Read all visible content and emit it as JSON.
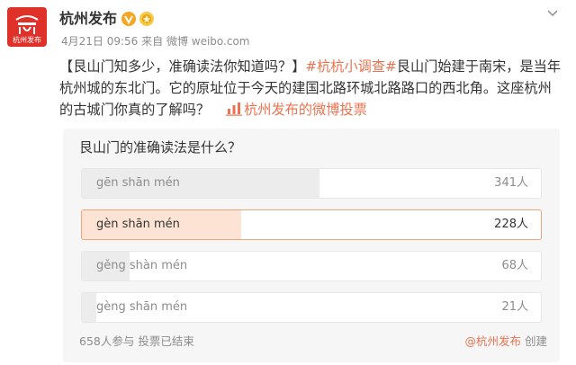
{
  "account": {
    "name": "杭州发布",
    "avatar_text": "杭州发布",
    "avatar_color": "#e0302a"
  },
  "meta": {
    "date": "4月21日 09:56",
    "source": "来自 微博 weibo.com"
  },
  "post": {
    "text_lead": "【艮山门知多少，准确读法你知道吗？】",
    "topic": "#杭杭小调查#",
    "text_body": "艮山门始建于南宋，是当年杭州城的东北门。它的原址位于今天的建国北路环城北路路口的西北角。这座杭州的古城门你真的了解吗？",
    "poll_link": "杭州发布的微博投票",
    "accent_color": "#eb7350"
  },
  "poll": {
    "question": "艮山门的准确读法是什么？",
    "options": [
      {
        "label": "gēn shān mén",
        "count": "341人",
        "votes": 341,
        "selected": false
      },
      {
        "label": "gèn shān mén",
        "count": "228人",
        "votes": 228,
        "selected": true
      },
      {
        "label": "gěng shàn mén",
        "count": "68人",
        "votes": 68,
        "selected": false
      },
      {
        "label": "gèng shān mén",
        "count": "21人",
        "votes": 21,
        "selected": false
      }
    ],
    "total_votes": 658,
    "footer_status": "658人参与 投票已结束",
    "creator": "@杭州发布",
    "creator_suffix": "创建"
  },
  "icons": {
    "verified": "verified-v-icon",
    "badge": "gold-badge-icon",
    "more": "chevron-down-icon",
    "poll": "poll-icon"
  }
}
